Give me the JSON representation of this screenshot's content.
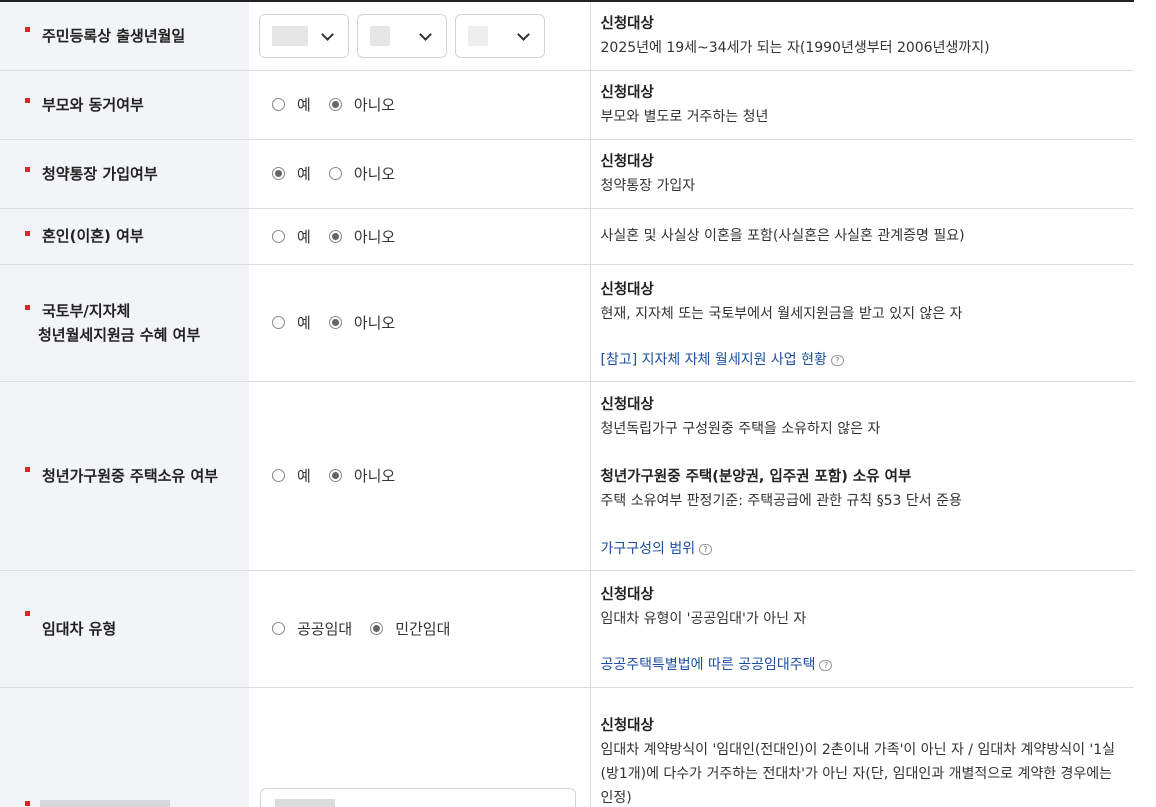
{
  "rows": [
    {
      "label": "주민등록상 출생년월일",
      "desc_title": "신청대상",
      "desc_text": "2025년에 19세~34세가 되는 자(1990년생부터 2006년생까지)"
    },
    {
      "label": "부모와 동거여부",
      "options": [
        "예",
        "아니오"
      ],
      "selected": "아니오",
      "desc_title": "신청대상",
      "desc_text": "부모와 별도로 거주하는 청년"
    },
    {
      "label": "청약통장 가입여부",
      "options": [
        "예",
        "아니오"
      ],
      "selected": "예",
      "desc_title": "신청대상",
      "desc_text": "청약통장 가입자"
    },
    {
      "label": "혼인(이혼) 여부",
      "options": [
        "예",
        "아니오"
      ],
      "selected": "아니오",
      "desc_text": "사실혼 및 사실상 이혼을 포함(사실혼은 사실혼 관계증명 필요)"
    },
    {
      "label_line1": "국토부/지자체",
      "label_line2": "청년월세지원금 수혜 여부",
      "options": [
        "예",
        "아니오"
      ],
      "selected": "아니오",
      "desc_title": "신청대상",
      "desc_text": "현재, 지자체 또는 국토부에서 월세지원금을 받고 있지 않은 자",
      "link": "[참고] 지자체 자체 월세지원 사업 현황"
    },
    {
      "label": "청년가구원중 주택소유 여부",
      "options": [
        "예",
        "아니오"
      ],
      "selected": "아니오",
      "desc_title": "신청대상",
      "desc_text": "청년독립가구 구성원중 주택을 소유하지 않은 자",
      "desc_title2": "청년가구원중 주택(분양권, 입주권 포함) 소유 여부",
      "desc_text2": "주택 소유여부 판정기준: 주택공급에 관한 규칙 §53 단서 준용",
      "link": "가구구성의 범위"
    },
    {
      "label": "임대차 유형",
      "options": [
        "공공임대",
        "민간임대"
      ],
      "selected": "민간임대",
      "desc_title": "신청대상",
      "desc_text": "임대차 유형이 '공공임대'가 아닌 자",
      "link": "공공주택특별법에 따른 공공임대주택"
    },
    {
      "desc_title": "신청대상",
      "desc_text": "임대차 계약방식이 '임대인(전대인)이 2촌이내 가족'이 아닌 자 / 임대차 계약방식이 '1실(방1개)에 다수가 거주하는 전대차'가 아닌 자(단, 임대인과 개별적으로 계약한 경우에는 인정)"
    }
  ],
  "help_icon": "question-bubble-icon",
  "colors": {
    "bullet": "#e8202a",
    "label_bg": "#f3f4f8",
    "link": "#1d4fa0"
  }
}
